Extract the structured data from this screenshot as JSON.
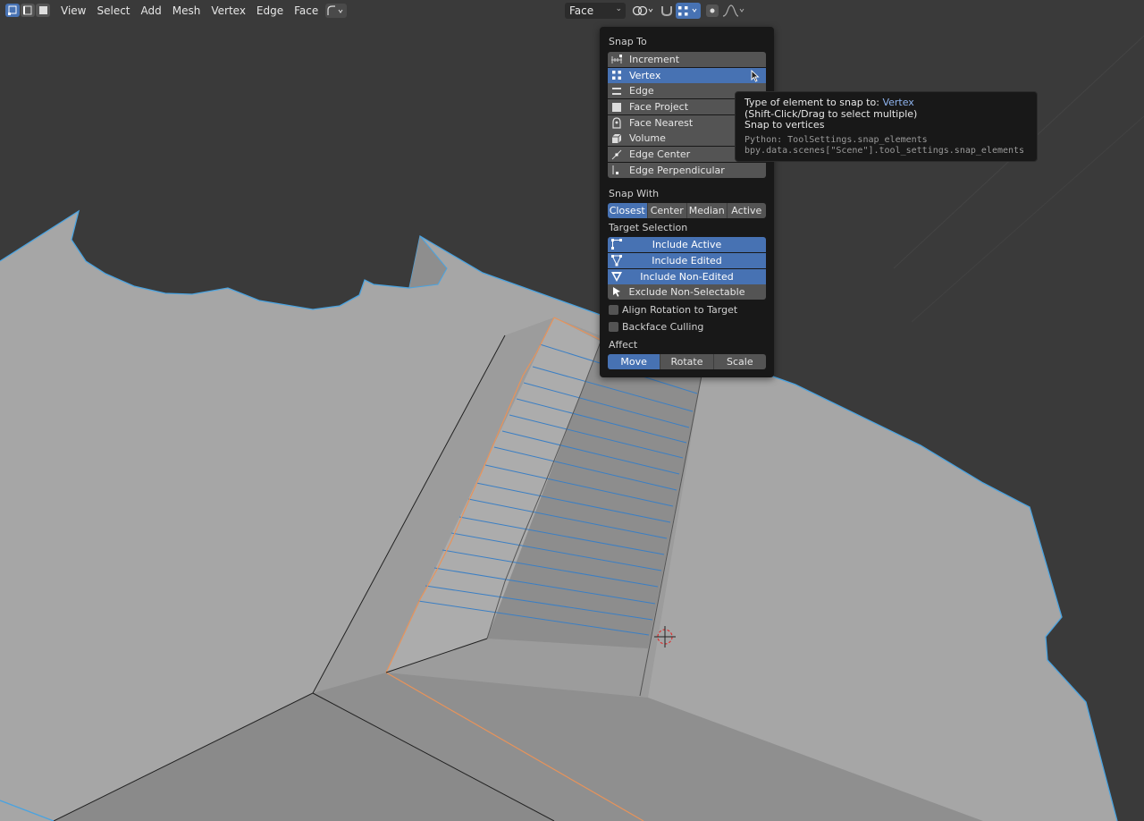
{
  "header": {
    "menu": [
      "View",
      "Select",
      "Add",
      "Mesh",
      "Vertex",
      "Edge",
      "Face",
      "UV"
    ],
    "transform_pivot": "Face"
  },
  "snap_popover": {
    "snap_to_label": "Snap To",
    "snap_to_items": [
      {
        "label": "Increment",
        "icon": "increment-icon",
        "selected": false
      },
      {
        "label": "Vertex",
        "icon": "vertex-icon",
        "selected": true
      },
      {
        "label": "Edge",
        "icon": "edge-icon",
        "selected": false
      },
      {
        "label": "Face Project",
        "icon": "face-project-icon",
        "selected": false
      },
      {
        "label": "Face Nearest",
        "icon": "face-nearest-icon",
        "selected": false
      },
      {
        "label": "Volume",
        "icon": "volume-icon",
        "selected": false
      },
      {
        "label": "Edge Center",
        "icon": "edge-center-icon",
        "selected": false
      },
      {
        "label": "Edge Perpendicular",
        "icon": "edge-perpendicular-icon",
        "selected": false
      }
    ],
    "snap_with_label": "Snap With",
    "snap_with_options": [
      "Closest",
      "Center",
      "Median",
      "Active"
    ],
    "snap_with_active": "Closest",
    "target_selection_label": "Target Selection",
    "target_items": [
      {
        "label": "Include Active",
        "active": true
      },
      {
        "label": "Include Edited",
        "active": true
      },
      {
        "label": "Include Non-Edited",
        "active": true
      },
      {
        "label": "Exclude Non-Selectable",
        "active": false
      }
    ],
    "align_rotation_label": "Align Rotation to Target",
    "align_rotation_checked": false,
    "backface_culling_label": "Backface Culling",
    "backface_culling_checked": false,
    "affect_label": "Affect",
    "affect_options": [
      "Move",
      "Rotate",
      "Scale"
    ],
    "affect_active": "Move"
  },
  "tooltip": {
    "line1_prefix": "Type of element to snap to:",
    "line1_value": "Vertex",
    "line2": "(Shift-Click/Drag to select multiple)",
    "line3": "Snap to vertices",
    "python1": "Python: ToolSettings.snap_elements",
    "python2": "bpy.data.scenes[\"Scene\"].tool_settings.snap_elements"
  },
  "colors": {
    "accent": "#4772b3",
    "viewport_bg": "#3a3a3a",
    "mesh_face": "#a5a5a5",
    "selected_edge": "#e8935a",
    "boundary_edge": "#4aa3e0"
  }
}
